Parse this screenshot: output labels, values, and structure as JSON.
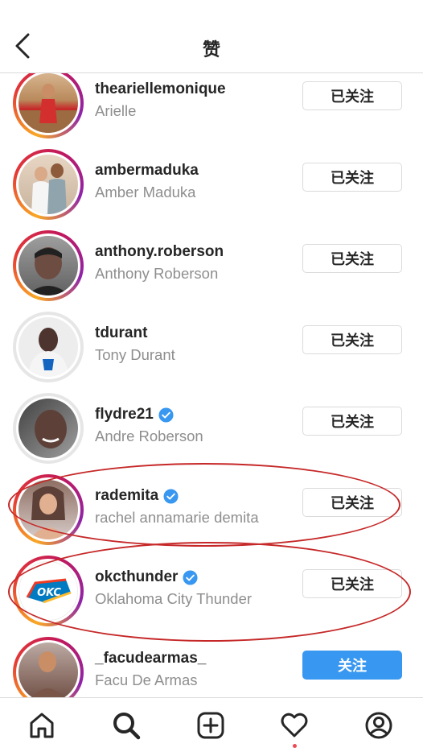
{
  "header": {
    "title": "赞"
  },
  "follow_labels": {
    "following": "已关注",
    "follow": "关注"
  },
  "users": [
    {
      "username": "theariellemonique",
      "fullname": "Arielle",
      "verified": false,
      "button": "已关注",
      "avatar_icon": "user-photo"
    },
    {
      "username": "ambermaduka",
      "fullname": "Amber Maduka",
      "verified": false,
      "button": "已关注",
      "avatar_icon": "user-photo"
    },
    {
      "username": "anthony.roberson",
      "fullname": "Anthony Roberson",
      "verified": false,
      "button": "已关注",
      "avatar_icon": "user-photo"
    },
    {
      "username": "tdurant",
      "fullname": "Tony Durant",
      "verified": false,
      "button": "已关注",
      "avatar_icon": "user-photo"
    },
    {
      "username": "flydre21",
      "fullname": "Andre Roberson",
      "verified": true,
      "button": "已关注",
      "avatar_icon": "user-photo"
    },
    {
      "username": "rademita",
      "fullname": "rachel annamarie demita",
      "verified": true,
      "button": "已关注",
      "avatar_icon": "user-photo"
    },
    {
      "username": "okcthunder",
      "fullname": "Oklahoma City Thunder",
      "verified": true,
      "button": "已关注",
      "avatar_icon": "team-logo",
      "logo_text": "OKC"
    },
    {
      "username": "_facudearmas_",
      "fullname": "Facu De Armas",
      "verified": false,
      "button": "关注",
      "avatar_icon": "user-photo"
    }
  ],
  "tabbar": {
    "tabs": [
      "home-icon",
      "search-icon",
      "new-post-icon",
      "activity-icon",
      "profile-icon"
    ],
    "active": "search-icon"
  },
  "colors": {
    "verified": "#3897f0",
    "follow_button": "#3897f0",
    "annotation_circle": "#c62828",
    "notification_dot": "#ed4956"
  }
}
